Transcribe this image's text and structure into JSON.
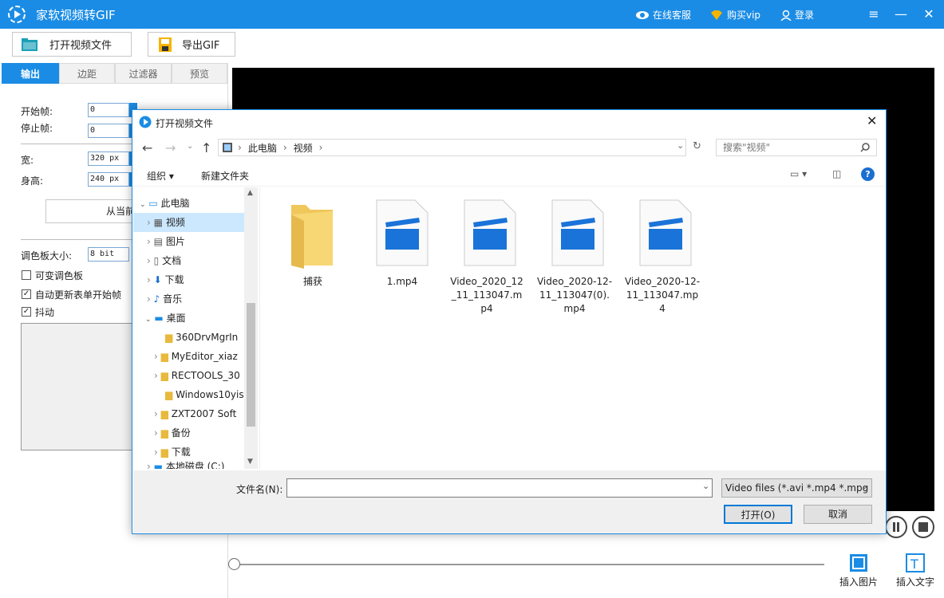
{
  "app": {
    "title": "家软视频转GIF",
    "online_service": "在线客服",
    "buy_vip": "购买vip",
    "login": "登录"
  },
  "toolbar": {
    "open_video": "打开视频文件",
    "export_gif": "导出GIF"
  },
  "left": {
    "tabs": [
      "输出",
      "边距",
      "过滤器",
      "预览"
    ],
    "start_frame_label": "开始帧:",
    "start_frame_value": "0",
    "stop_frame_label": "停止帧:",
    "stop_frame_value": "0",
    "width_label": "宽:",
    "width_value": "320 px",
    "height_label": "身高:",
    "height_value": "240 px",
    "from_current_button": "从当前帧",
    "palette_label": "调色板大小:",
    "palette_value": "8 bit",
    "variable_palette": "可变调色板",
    "auto_update": "自动更新表单开始帧",
    "dither": "抖动",
    "variable_palette_checked": false,
    "auto_update_checked": true,
    "dither_checked": true
  },
  "dialog": {
    "title": "打开视频文件",
    "breadcrumb": [
      "此电脑",
      "视频"
    ],
    "search_placeholder": "搜索\"视频\"",
    "organize": "组织",
    "new_folder": "新建文件夹",
    "nav": [
      "此电脑",
      "视频",
      "图片",
      "文档",
      "下载",
      "音乐",
      "桌面",
      "360DrvMgrIn",
      "MyEditor_xiaz",
      "RECTOOLS_30",
      "Windows10yis",
      "ZXT2007 Soft",
      "备份",
      "下载",
      "本地磁盘 (C:)"
    ],
    "files": [
      "捕获",
      "1.mp4",
      "Video_2020_12_11_113047.mp4",
      "Video_2020-12-11_113047(0).mp4",
      "Video_2020-12-11_113047.mp4"
    ],
    "filename_label": "文件名(N):",
    "filename_value": "",
    "filter": "Video files (*.avi *.mp4 *.mpg",
    "open_button": "打开(O)",
    "cancel_button": "取消"
  },
  "bottom": {
    "insert_image": "插入图片",
    "insert_text": "插入文字"
  },
  "colors": {
    "accent": "#1a8ce5",
    "video_bg": "#000000",
    "folder": "#f7d674"
  }
}
